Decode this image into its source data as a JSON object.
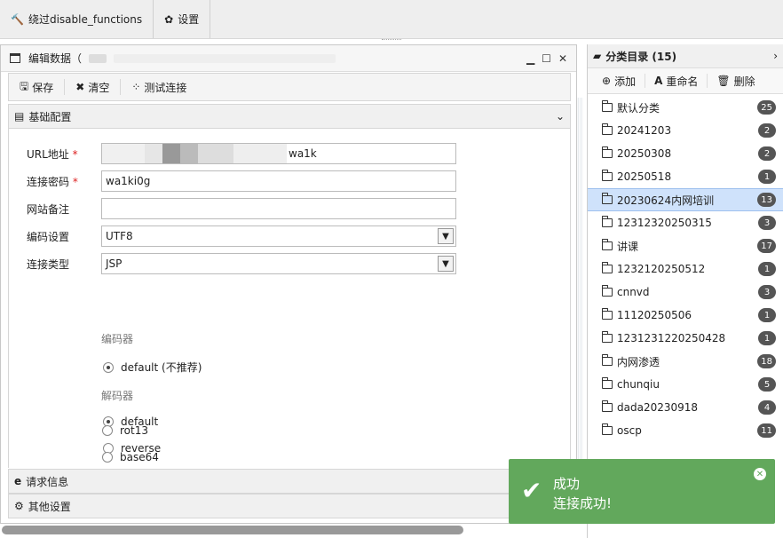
{
  "topbar": {
    "bypass_label": "绕过disable_functions",
    "settings_label": "设置"
  },
  "editor": {
    "title": "编辑数据（",
    "toolbar": {
      "save": "保存",
      "clear": "清空",
      "test": "测试连接"
    },
    "section_basic": "基础配置",
    "url_label": "URL地址",
    "url_value": "wa1k",
    "password_label": "连接密码",
    "password_value": "wa1ki0g",
    "note_label": "网站备注",
    "note_value": "",
    "encoding_label": "编码设置",
    "encoding_value": "UTF8",
    "type_label": "连接类型",
    "type_value": "JSP",
    "encoder_group": "编码器",
    "encoder_default": "default (不推荐)",
    "decoder_group": "解码器",
    "decoder_options": [
      "default",
      "reverse",
      "rot13",
      "base64"
    ],
    "section_request": "请求信息",
    "section_other": "其他设置",
    "required_mark": "*"
  },
  "sidebar": {
    "title": "分类目录 (15)",
    "tools": {
      "add": "添加",
      "rename": "重命名",
      "delete": "删除"
    },
    "items": [
      {
        "name": "默认分类",
        "count": "25"
      },
      {
        "name": "20241203",
        "count": "2"
      },
      {
        "name": "20250308",
        "count": "2"
      },
      {
        "name": "20250518",
        "count": "1"
      },
      {
        "name": "20230624内网培训",
        "count": "13"
      },
      {
        "name": "12312320250315",
        "count": "3"
      },
      {
        "name": "讲课",
        "count": "17"
      },
      {
        "name": "1232120250512",
        "count": "1"
      },
      {
        "name": "cnnvd",
        "count": "3"
      },
      {
        "name": "11120250506",
        "count": "1"
      },
      {
        "name": "1231231220250428",
        "count": "1"
      },
      {
        "name": "内网渗透",
        "count": "18"
      },
      {
        "name": "chunqiu",
        "count": "5"
      },
      {
        "name": "dada20230918",
        "count": "4"
      },
      {
        "name": "oscp",
        "count": "11"
      }
    ]
  },
  "toast": {
    "title": "成功",
    "message": "连接成功!"
  }
}
